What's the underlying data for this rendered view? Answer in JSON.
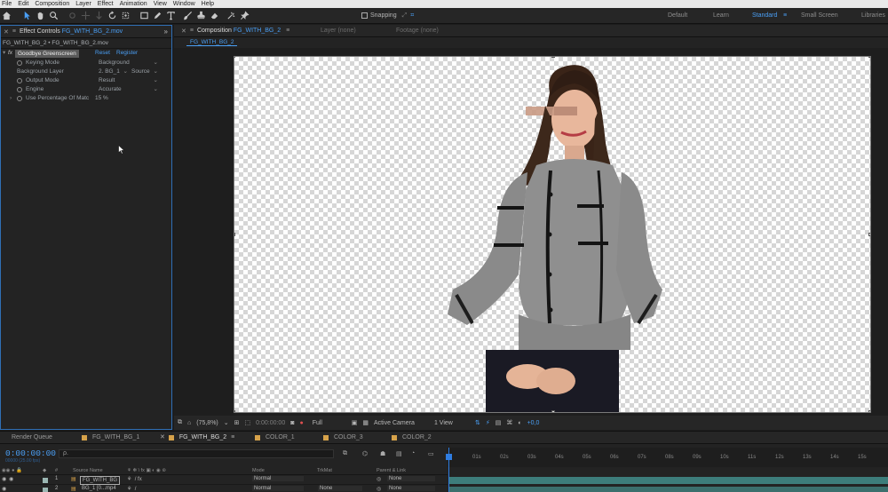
{
  "menu": [
    "File",
    "Edit",
    "Composition",
    "Layer",
    "Effect",
    "Animation",
    "View",
    "Window",
    "Help"
  ],
  "toolbar": {
    "snapping_label": "Snapping",
    "workspaces": [
      "Default",
      "Learn",
      "Standard",
      "Small Screen",
      "Libraries"
    ],
    "active_workspace": "Standard",
    "active_workspace_menu_icon": "≡"
  },
  "effect_controls": {
    "tab_label": "Effect Controls",
    "tab_comp": "FG_WITH_BG_2.mov",
    "subtitle": "FG_WITH_BG_2 • FG_WITH_BG_2.mov",
    "effect_name": "Goodbye Greenscreen",
    "reset_label": "Reset",
    "register_label": "Register",
    "fx_label": "fx",
    "params": [
      {
        "name": "Keying Mode",
        "value": "Background"
      },
      {
        "name": "Background Layer",
        "value": "2. BG_1",
        "source": "Source"
      },
      {
        "name": "Output Mode",
        "value": "Result"
      },
      {
        "name": "Engine",
        "value": "Accurate"
      },
      {
        "name": "Use Percentage Of Matc",
        "value": "15 %"
      }
    ]
  },
  "composition": {
    "tab_prefix": "Composition",
    "tab_comp": "FG_WITH_BG_2",
    "layer_tab": "Layer  (none)",
    "footage_tab": "Footage  (none)",
    "breadcrumb": "FG_WITH_BG_2"
  },
  "viewer_bar": {
    "zoom": "(75,8%)",
    "timecode": "0:00:00:00",
    "resolution": "Full",
    "camera": "Active Camera",
    "views": "1 View",
    "exposure": "+0,0"
  },
  "timeline": {
    "tabs": [
      {
        "label": "Render Queue",
        "color": null
      },
      {
        "label": "FG_WITH_BG_1",
        "color": "#d6a24a"
      },
      {
        "label": "FG_WITH_BG_2",
        "color": "#d6a24a",
        "active": true
      },
      {
        "label": "COLOR_1",
        "color": "#d6a24a"
      },
      {
        "label": "COLOR_3",
        "color": "#d6a24a"
      },
      {
        "label": "COLOR_2",
        "color": "#d6a24a"
      }
    ],
    "current_time": "0:00:00:00",
    "fps": "00000 (25.00 fps)",
    "search_placeholder": "ρ.",
    "ruler": [
      "01s",
      "02s",
      "03s",
      "04s",
      "05s",
      "06s",
      "07s",
      "08s",
      "09s",
      "10s",
      "11s",
      "12s",
      "13s",
      "14s",
      "15s"
    ],
    "columns": {
      "source_name": "Source Name",
      "mode": "Mode",
      "trkmat": "TrkMat",
      "parent": "Parent & Link"
    },
    "layers": [
      {
        "num": "1",
        "name": "FG_WITH_BG",
        "mode": "Normal",
        "trkmat": "",
        "parent": "None",
        "bar_color": "#3d7d7b"
      },
      {
        "num": "2",
        "name": "BG_1 [0...mp4",
        "mode": "Normal",
        "trkmat": "None",
        "parent": "None",
        "bar_color": "#3b6f6d"
      }
    ]
  },
  "colors": {
    "accent": "#4a9ff5",
    "panel_border": "#2f6fb5"
  }
}
